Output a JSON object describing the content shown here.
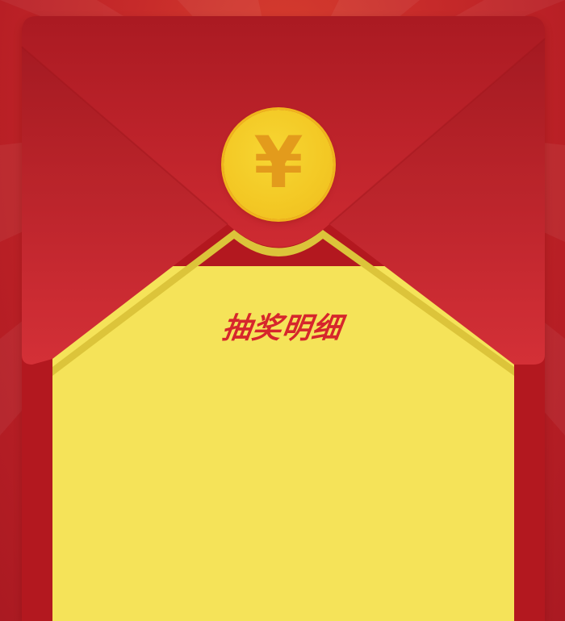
{
  "coin": {
    "symbol": "¥",
    "icon": "yuan-coin-icon"
  },
  "title": "抽奖明细",
  "colors": {
    "background": "#c12726",
    "envelope_flap": "#d32b31",
    "letter_card": "#f5e359",
    "card_border": "#dcc43a",
    "coin": "#f3c824",
    "coin_symbol": "#e39b1c",
    "title": "#d6262c"
  }
}
